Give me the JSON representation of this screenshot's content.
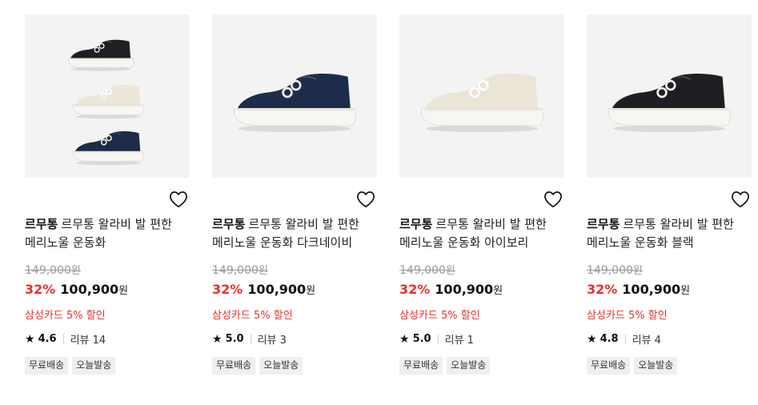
{
  "products": [
    {
      "brand": "르무통",
      "name": "르무통 왈라비 발 편한 메리노울 운동화",
      "original_price": "149,000",
      "discount_rate": "32%",
      "sale_price": "100,900",
      "currency": "원",
      "card_benefit": "삼성카드 5% 할인",
      "rating": "4.6",
      "review_label": "리뷰 14",
      "tags": [
        "무료배송",
        "오늘발송"
      ],
      "image_variant": "trio",
      "colors": [
        "#1f1f24",
        "#ece6d8",
        "#1c2b48"
      ]
    },
    {
      "brand": "르무통",
      "name": "르무통 왈라비 발 편한 메리노울 운동화 다크네이비",
      "original_price": "149,000",
      "discount_rate": "32%",
      "sale_price": "100,900",
      "currency": "원",
      "card_benefit": "삼성카드 5% 할인",
      "rating": "5.0",
      "review_label": "리뷰 3",
      "tags": [
        "무료배송",
        "오늘발송"
      ],
      "image_variant": "single",
      "colors": [
        "#1d2c4a"
      ]
    },
    {
      "brand": "르무통",
      "name": "르무통 왈라비 발 편한 메리노울 운동화 아이보리",
      "original_price": "149,000",
      "discount_rate": "32%",
      "sale_price": "100,900",
      "currency": "원",
      "card_benefit": "삼성카드 5% 할인",
      "rating": "5.0",
      "review_label": "리뷰 1",
      "tags": [
        "무료배송",
        "오늘발송"
      ],
      "image_variant": "single",
      "colors": [
        "#ebe5d6"
      ]
    },
    {
      "brand": "르무통",
      "name": "르무통 왈라비 발 편한 메리노울 운동화 블랙",
      "original_price": "149,000",
      "discount_rate": "32%",
      "sale_price": "100,900",
      "currency": "원",
      "card_benefit": "삼성카드 5% 할인",
      "rating": "4.8",
      "review_label": "리뷰 4",
      "tags": [
        "무료배송",
        "오늘발송"
      ],
      "image_variant": "single",
      "colors": [
        "#1f1f23"
      ]
    }
  ],
  "icons": {
    "wishlist": "heart-outline-icon",
    "rating": "star-icon"
  },
  "theme": {
    "accent": "#e4312b",
    "thumb_bg": "#f3f3f3",
    "tag_bg": "#efefef"
  }
}
